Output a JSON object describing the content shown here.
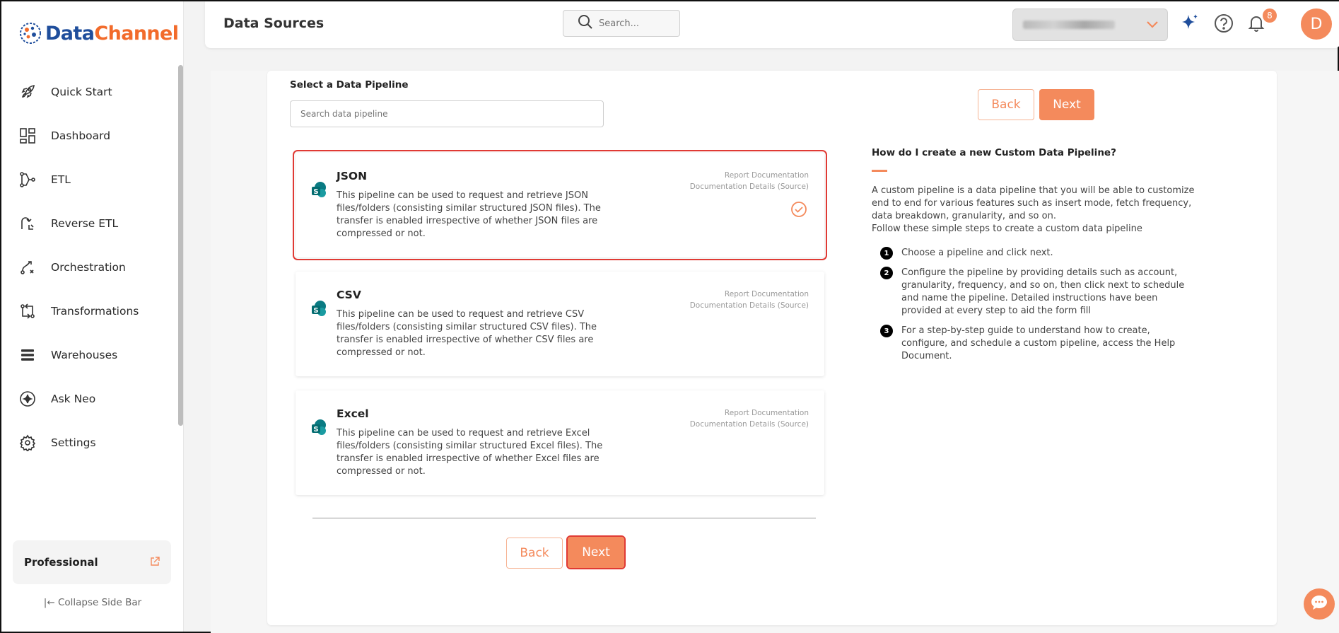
{
  "brand": {
    "part1": "Data",
    "part2": "Channel",
    "color_primary": "#1f4e9c",
    "color_accent": "#f26b2b"
  },
  "sidebar": {
    "items": [
      {
        "label": "Quick Start",
        "icon": "rocket-icon"
      },
      {
        "label": "Dashboard",
        "icon": "dashboard-grid-icon"
      },
      {
        "label": "ETL",
        "icon": "etl-flow-icon"
      },
      {
        "label": "Reverse ETL",
        "icon": "reverse-etl-icon"
      },
      {
        "label": "Orchestration",
        "icon": "orchestration-icon"
      },
      {
        "label": "Transformations",
        "icon": "transformations-icon"
      },
      {
        "label": "Warehouses",
        "icon": "warehouse-stack-icon"
      },
      {
        "label": "Ask Neo",
        "icon": "sparkle-icon"
      },
      {
        "label": "Settings",
        "icon": "gear-icon"
      }
    ],
    "plan": "Professional",
    "collapse_label": "Collapse Side Bar"
  },
  "header": {
    "title": "Data Sources",
    "search_placeholder": "Search...",
    "notification_count": "8",
    "avatar_initial": "D"
  },
  "main": {
    "select_label": "Select a Data Pipeline",
    "search_placeholder": "Search data pipeline",
    "back_label": "Back",
    "next_label": "Next",
    "doc_link_1": "Report Documentation",
    "doc_link_2": "Documentation Details (Source)",
    "cards": [
      {
        "title": "JSON",
        "desc": "This pipeline can be used to request and retrieve JSON files/folders (consisting similar structured JSON files). The transfer is enabled irrespective of whether JSON files are compressed or not.",
        "selected": true
      },
      {
        "title": "CSV",
        "desc": "This pipeline can be used to request and retrieve CSV files/folders (consisting similar structured CSV files). The transfer is enabled irrespective of whether CSV files are compressed or not.",
        "selected": false
      },
      {
        "title": "Excel",
        "desc": "This pipeline can be used to request and retrieve Excel files/folders (consisting similar structured Excel files). The transfer is enabled irrespective of whether Excel files are compressed or not.",
        "selected": false
      }
    ]
  },
  "help": {
    "title": "How do I create a new Custom Data Pipeline?",
    "intro": "A custom pipeline is a data pipeline that you will be able to customize end to end for various features such as insert mode, fetch frequency, data breakdown, granularity, and so on.",
    "intro2": "Follow these simple steps to create a custom data pipeline",
    "steps": [
      {
        "num": "1",
        "text": "Choose a pipeline and click next."
      },
      {
        "num": "2",
        "text": "Configure the pipeline by providing details such as account, granularity, frequency, and so on, then click next to schedule and name the pipeline. Detailed instructions have been provided at every step to aid the form fill"
      },
      {
        "num": "3",
        "text": "For a step-by-step guide to understand how to create, configure, and schedule a custom pipeline, access the Help Document."
      }
    ]
  },
  "colors": {
    "accent": "#f48a5c",
    "selected_border": "#e03a34"
  }
}
